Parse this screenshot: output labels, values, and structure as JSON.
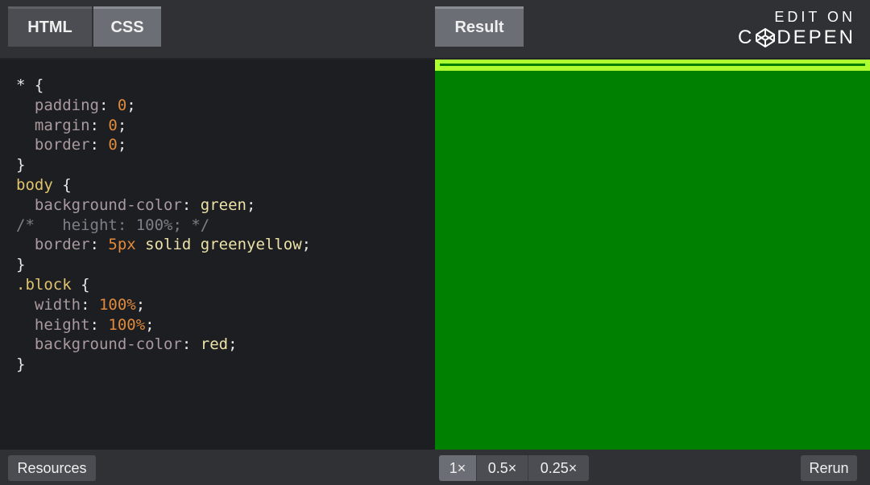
{
  "tabs": {
    "html": "HTML",
    "css": "CSS",
    "result": "Result"
  },
  "brand": {
    "line1": "EDIT ON",
    "pen_prefix": "C",
    "pen_suffix": "DEPEN"
  },
  "code_lines": [
    [
      {
        "t": "* {",
        "c": "sel"
      }
    ],
    [
      {
        "t": "  padding",
        "c": "prop"
      },
      {
        "t": ": ",
        "c": "punc"
      },
      {
        "t": "0",
        "c": "num"
      },
      {
        "t": ";",
        "c": "punc"
      }
    ],
    [
      {
        "t": "  margin",
        "c": "prop"
      },
      {
        "t": ": ",
        "c": "punc"
      },
      {
        "t": "0",
        "c": "num"
      },
      {
        "t": ";",
        "c": "punc"
      }
    ],
    [
      {
        "t": "  border",
        "c": "prop"
      },
      {
        "t": ": ",
        "c": "punc"
      },
      {
        "t": "0",
        "c": "num"
      },
      {
        "t": ";",
        "c": "punc"
      }
    ],
    [
      {
        "t": "}",
        "c": "punc"
      }
    ],
    [
      {
        "t": "body",
        "c": "tag"
      },
      {
        "t": " {",
        "c": "punc"
      }
    ],
    [
      {
        "t": "  background-color",
        "c": "prop"
      },
      {
        "t": ": ",
        "c": "punc"
      },
      {
        "t": "green",
        "c": "val"
      },
      {
        "t": ";",
        "c": "punc"
      }
    ],
    [
      {
        "t": "/*   height: 100%; */",
        "c": "com"
      }
    ],
    [
      {
        "t": "  border",
        "c": "prop"
      },
      {
        "t": ": ",
        "c": "punc"
      },
      {
        "t": "5px",
        "c": "num"
      },
      {
        "t": " solid greenyellow",
        "c": "val"
      },
      {
        "t": ";",
        "c": "punc"
      }
    ],
    [
      {
        "t": "}",
        "c": "punc"
      }
    ],
    [
      {
        "t": ".block",
        "c": "tag"
      },
      {
        "t": " {",
        "c": "punc"
      }
    ],
    [
      {
        "t": "  width",
        "c": "prop"
      },
      {
        "t": ": ",
        "c": "punc"
      },
      {
        "t": "100%",
        "c": "num"
      },
      {
        "t": ";",
        "c": "punc"
      }
    ],
    [
      {
        "t": "  height",
        "c": "prop"
      },
      {
        "t": ": ",
        "c": "punc"
      },
      {
        "t": "100%",
        "c": "num"
      },
      {
        "t": ";",
        "c": "punc"
      }
    ],
    [
      {
        "t": "  background-color",
        "c": "prop"
      },
      {
        "t": ": ",
        "c": "punc"
      },
      {
        "t": "red",
        "c": "val"
      },
      {
        "t": ";",
        "c": "punc"
      }
    ],
    [
      {
        "t": "}",
        "c": "punc"
      }
    ]
  ],
  "bottom": {
    "resources": "Resources",
    "zoom_options": [
      "1×",
      "0.5×",
      "0.25×"
    ],
    "zoom_selected": "1×",
    "rerun": "Rerun"
  },
  "colors": {
    "result_background": "#008000",
    "result_border": "#adff2f"
  }
}
